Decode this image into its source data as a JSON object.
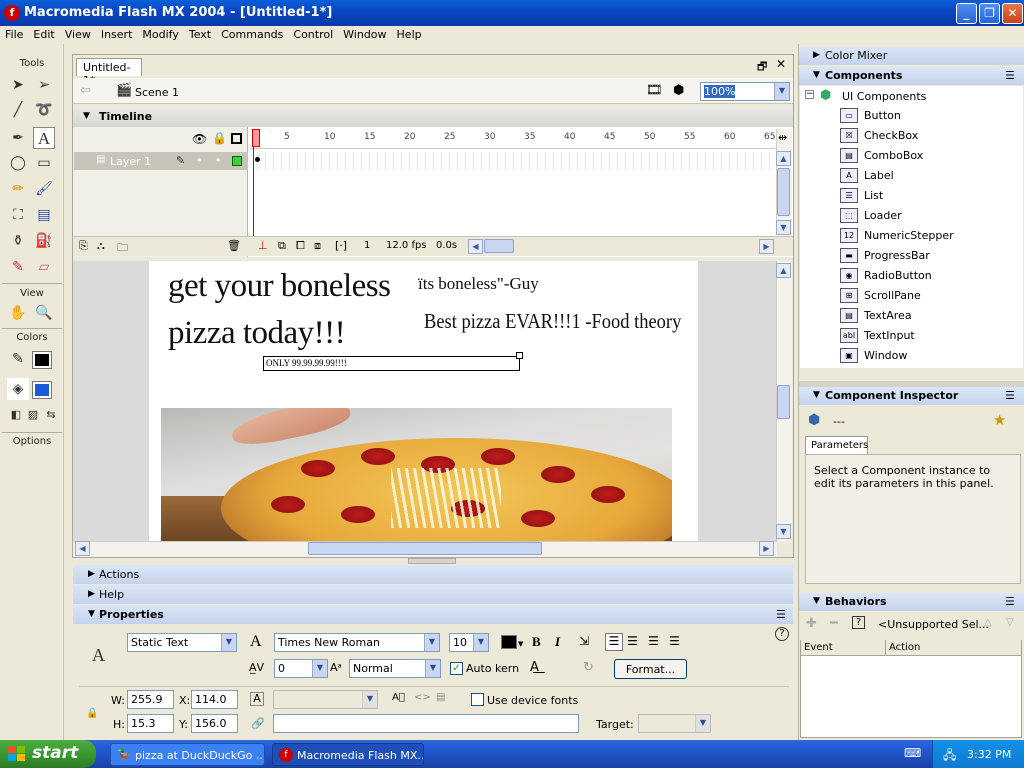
{
  "window": {
    "title": "Macromedia Flash MX 2004 - [Untitled-1*]",
    "logo": "f"
  },
  "menu": [
    "File",
    "Edit",
    "View",
    "Insert",
    "Modify",
    "Text",
    "Commands",
    "Control",
    "Window",
    "Help"
  ],
  "tools": {
    "header": "Tools",
    "view_label": "View",
    "colors_label": "Colors",
    "options_label": "Options",
    "text_tool_glyph": "A"
  },
  "document": {
    "tab": "Untitled-1*",
    "scene": "Scene 1",
    "zoom": "100%",
    "timeline_title": "Timeline",
    "layer_name": "Layer 1",
    "frame_numbers": [
      "1",
      "5",
      "10",
      "15",
      "20",
      "25",
      "30",
      "35",
      "40",
      "45",
      "50",
      "55",
      "60",
      "65"
    ],
    "current_frame": "1",
    "fps": "12.0 fps",
    "time": "0.0s"
  },
  "stage": {
    "headline_line1": "get your boneless",
    "headline_line2": "pizza today!!!",
    "quote": "ïts boneless\"-Guy",
    "review": "Best pizza EVAR!!!1 -Food theory",
    "selected_text": "ONLY 99.99.99.99!!!!"
  },
  "panels": {
    "color_mixer": "Color Mixer",
    "components": "Components",
    "ui_components": "UI Components",
    "component_items": [
      "Button",
      "CheckBox",
      "ComboBox",
      "Label",
      "List",
      "Loader",
      "NumericStepper",
      "ProgressBar",
      "RadioButton",
      "ScrollPane",
      "TextArea",
      "TextInput",
      "Window"
    ],
    "component_inspector": "Component Inspector",
    "inspector_dash": "---",
    "parameters_tab": "Parameters",
    "inspector_message": "Select a Component instance to edit its parameters in this panel.",
    "behaviors": "Behaviors",
    "behaviors_select": "<Unsupported Sel...",
    "behaviors_col_event": "Event",
    "behaviors_col_action": "Action"
  },
  "lower": {
    "actions": "Actions",
    "help": "Help",
    "properties": "Properties"
  },
  "properties": {
    "text_type": "Static Text",
    "font": "Times New Roman",
    "font_size": "10",
    "bold": "B",
    "italic": "I",
    "letter_spacing": "0",
    "baseline": "Normal",
    "auto_kern": "Auto kern",
    "format_button": "Format...",
    "use_device_fonts": "Use device fonts",
    "w_label": "W:",
    "w": "255.9",
    "x_label": "X:",
    "x": "114.0",
    "h_label": "H:",
    "h": "15.3",
    "y_label": "Y:",
    "y": "156.0",
    "target_label": "Target:",
    "help_glyph": "?"
  },
  "taskbar": {
    "start": "start",
    "task1": "pizza at DuckDuckGo ...",
    "task2": "Macromedia Flash MX...",
    "clock": "3:32 PM"
  },
  "colors": {
    "accent": "#0a47c4",
    "stage_bg": "#ffffff",
    "taskbar": "#245edb"
  }
}
